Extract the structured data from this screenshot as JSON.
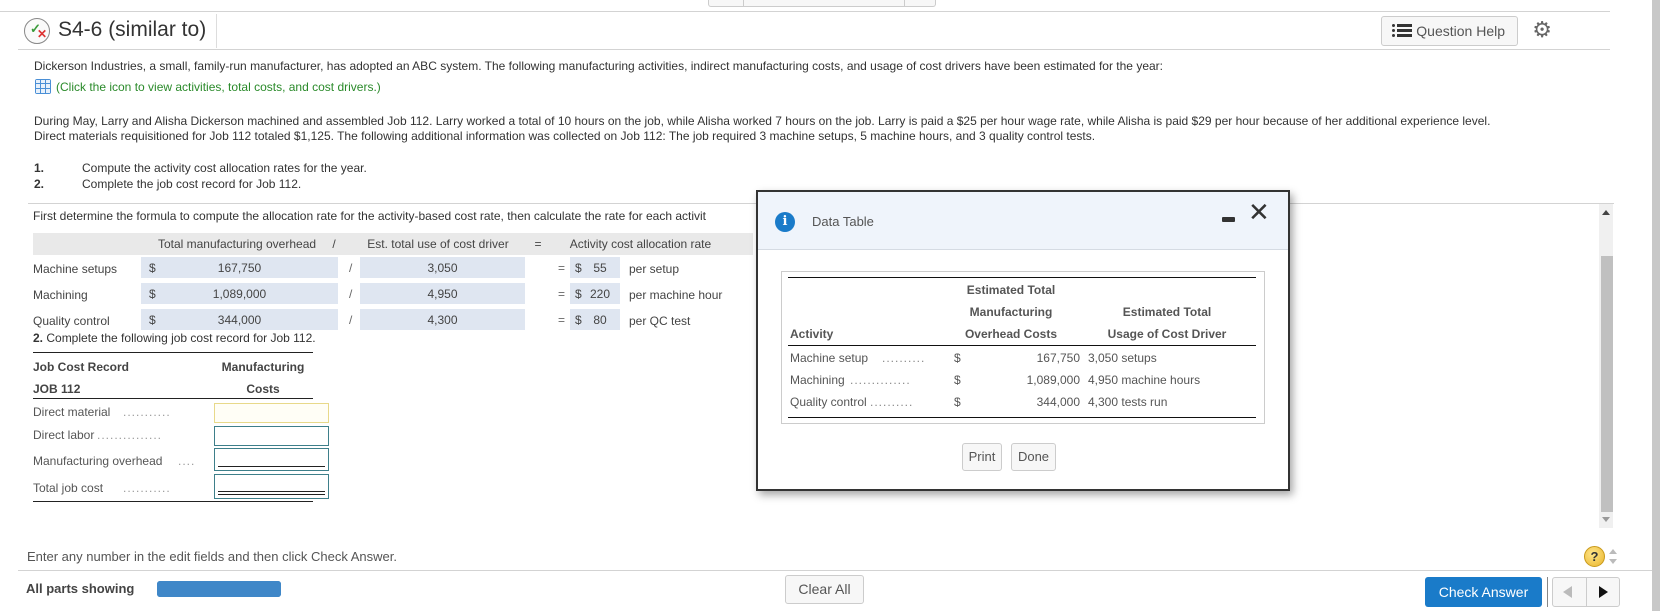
{
  "header": {
    "title": "S4-6 (similar to)",
    "status_icon": "partial-correct-icon",
    "question_help_label": "Question Help",
    "settings_icon": "gear-icon"
  },
  "problem": {
    "intro": "Dickerson Industries, a small, family-run manufacturer, has adopted an ABC system. The following manufacturing activities, indirect manufacturing costs, and usage of cost drivers have been estimated for the year:",
    "data_link": "(Click the icon to view activities, total costs, and cost drivers.)",
    "paragraph_line1": "During May, Larry and Alisha Dickerson machined and assembled Job 112. Larry worked a total of 10 hours on the job, while Alisha worked 7 hours on the job. Larry is paid a $25 per hour wage rate, while Alisha is paid $29 per hour because of her additional experience level.",
    "paragraph_line2": "Direct materials requisitioned for Job 112 totaled $1,125. The following additional information was collected on Job 112: The job required 3 machine setups, 5 machine hours, and 3 quality control tests.",
    "tasks": [
      {
        "num": "1.",
        "text": "Compute the activity cost allocation rates for the year."
      },
      {
        "num": "2.",
        "text": "Complete the job cost record for Job 112."
      }
    ]
  },
  "part1": {
    "instruction": "First determine the formula to compute the allocation rate for the activity-based cost rate, then calculate the rate for each activit",
    "headers": {
      "col1": "Total manufacturing overhead",
      "op1": "/",
      "col2": "Est. total use of cost driver",
      "op2": "=",
      "col3": "Activity cost allocation rate"
    },
    "rows": [
      {
        "label": "Machine setups",
        "dollar": "$",
        "overhead": "167,750",
        "div": "/",
        "driver": "3,050",
        "eq": "=",
        "rate_dollar": "$",
        "rate": "55",
        "unit": "per setup"
      },
      {
        "label": "Machining",
        "dollar": "$",
        "overhead": "1,089,000",
        "div": "/",
        "driver": "4,950",
        "eq": "=",
        "rate_dollar": "$",
        "rate": "220",
        "unit": "per machine hour"
      },
      {
        "label": "Quality control",
        "dollar": "$",
        "overhead": "344,000",
        "div": "/",
        "driver": "4,300",
        "eq": "=",
        "rate_dollar": "$",
        "rate": "80",
        "unit": "per QC test"
      }
    ]
  },
  "part2": {
    "prompt_num": "2.",
    "prompt_text": " Complete the following job cost record for Job 112.",
    "header_left1": "Job Cost Record",
    "header_left2": "JOB 112",
    "header_right1": "Manufacturing",
    "header_right2": "Costs",
    "rows": [
      {
        "label": "Direct material",
        "dots": "...........",
        "value": ""
      },
      {
        "label": "Direct labor",
        "dots": "...............",
        "value": ""
      },
      {
        "label": "Manufacturing overhead",
        "dots": "....",
        "value": ""
      },
      {
        "label": "Total job cost",
        "dots": "...........",
        "value": ""
      }
    ]
  },
  "modal": {
    "title": "Data Table",
    "headers": {
      "activity": "Activity",
      "cost1": "Estimated Total",
      "cost2": "Manufacturing",
      "cost3": "Overhead Costs",
      "usage1": "Estimated Total",
      "usage2": "Usage of Cost Driver"
    },
    "rows": [
      {
        "activity": "Machine setup",
        "dots": "..........",
        "dollar": "$",
        "cost": "167,750",
        "usage": "3,050 setups"
      },
      {
        "activity": "Machining",
        "dots": "..............",
        "dollar": "$",
        "cost": "1,089,000",
        "usage": "4,950 machine hours"
      },
      {
        "activity": "Quality control",
        "dots": "..........",
        "dollar": "$",
        "cost": "344,000",
        "usage": "4,300 tests run"
      }
    ],
    "print_label": "Print",
    "done_label": "Done"
  },
  "footer": {
    "hint": "Enter any number in the edit fields and then click Check Answer.",
    "all_parts_label": "All parts showing",
    "progress_percent": 100,
    "clear_all_label": "Clear All",
    "check_answer_label": "Check Answer",
    "help_label": "?"
  },
  "colors": {
    "accent": "#1a7bc9",
    "link_green": "#2a8a2a",
    "input_fill": "#dfe6f1",
    "progress": "#3f87c8"
  }
}
